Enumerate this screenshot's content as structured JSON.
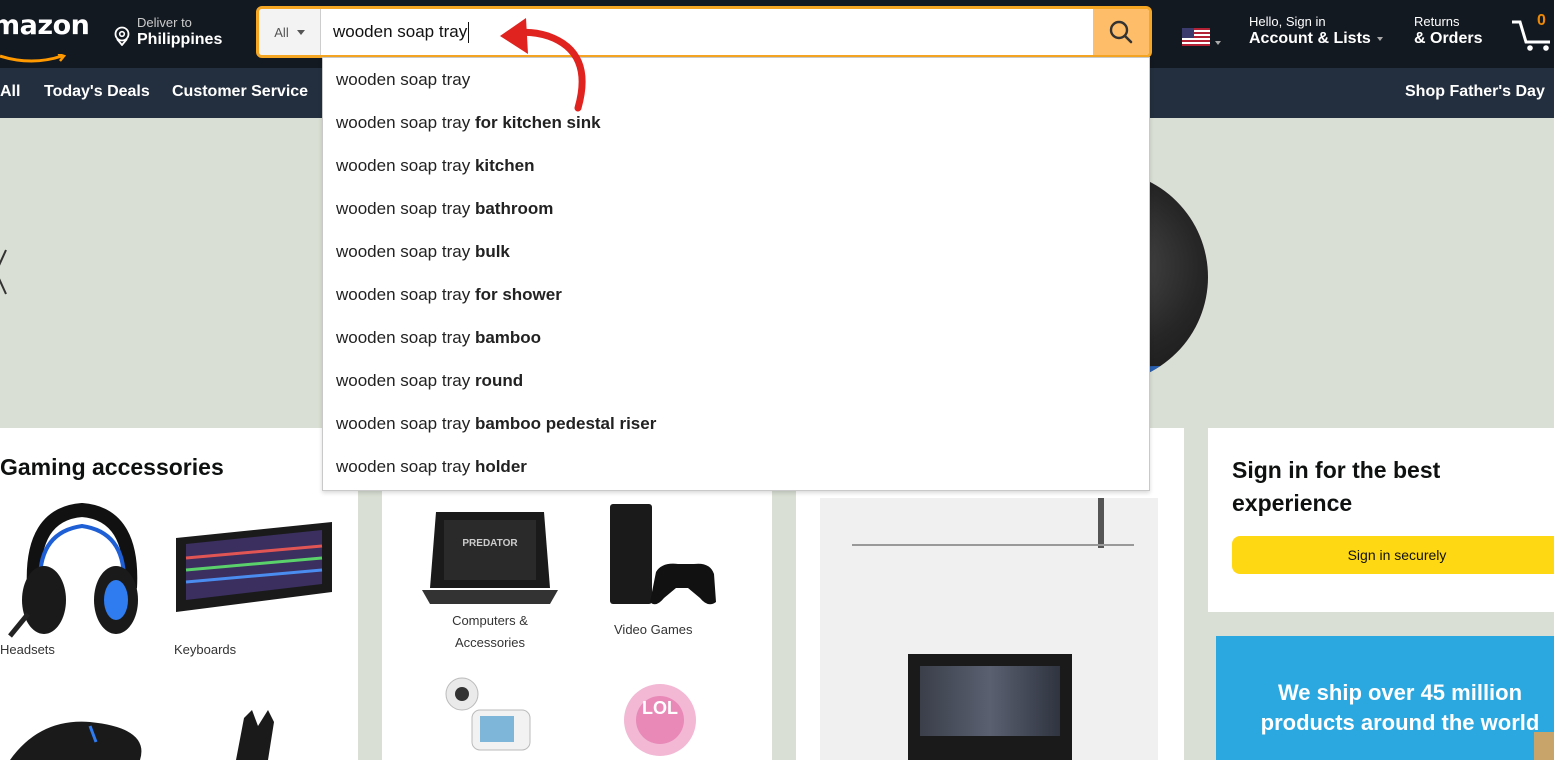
{
  "header": {
    "logo_text": "mazon",
    "deliver_line1": "Deliver to",
    "deliver_line2": "Philippines",
    "search_category": "All",
    "search_value": "wooden soap tray",
    "account_line1": "Hello, Sign in",
    "account_line2": "Account & Lists",
    "orders_line1": "Returns",
    "orders_line2": "& Orders",
    "cart_count": "0"
  },
  "subnav": {
    "all": "All",
    "todays_deals": "Today's Deals",
    "customer_service": "Customer Service",
    "promo": "Shop Father's Day"
  },
  "suggestions": [
    {
      "prefix": "wooden soap tray",
      "suffix": ""
    },
    {
      "prefix": "wooden soap tray",
      "suffix": "for kitchen sink"
    },
    {
      "prefix": "wooden soap tray",
      "suffix": "kitchen"
    },
    {
      "prefix": "wooden soap tray",
      "suffix": "bathroom"
    },
    {
      "prefix": "wooden soap tray",
      "suffix": "bulk"
    },
    {
      "prefix": "wooden soap tray",
      "suffix": "for shower"
    },
    {
      "prefix": "wooden soap tray",
      "suffix": "bamboo"
    },
    {
      "prefix": "wooden soap tray",
      "suffix": "round"
    },
    {
      "prefix": "wooden soap tray",
      "suffix": "bamboo pedestal riser"
    },
    {
      "prefix": "wooden soap tray",
      "suffix": "holder"
    }
  ],
  "cards": {
    "gaming": {
      "title": "Gaming accessories",
      "tiles": [
        "Headsets",
        "Keyboards"
      ]
    },
    "shop": {
      "tiles": [
        "Computers & Accessories",
        "Video Games"
      ]
    },
    "signin": {
      "title": "Sign in for the best experience",
      "button": "Sign in securely"
    },
    "ship": {
      "text": "We ship over 45 million products around the world"
    }
  },
  "colors": {
    "nav_bg": "#131921",
    "subnav_bg": "#232f3e",
    "search_button": "#febd69",
    "search_border": "#f5a623",
    "cart_count": "#f08804",
    "annotation_arrow": "#e0231f"
  }
}
